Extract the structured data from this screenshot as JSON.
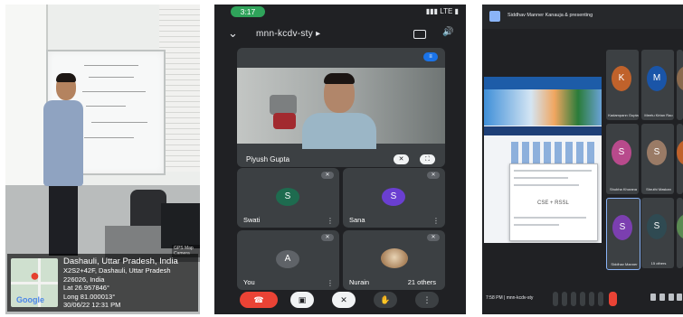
{
  "photo": {
    "geotag_title": "Dashauli, Uttar Pradesh, India",
    "address": "X2S2+42F, Dashauli, Uttar Pradesh 226026, India",
    "lat": "Lat 26.957846°",
    "long": "Long 81.000013°",
    "datetime": "30/06/22 12:31 PM",
    "map_label": "Google",
    "camera_badge": "GPS Map Camera"
  },
  "phone": {
    "status_time": "3:17",
    "status_right": "LTE",
    "meeting_code": "mnn-kcdv-sty",
    "main_tile_name": "Piyush Gupta",
    "tiles": [
      {
        "name": "Swati",
        "initial": "S",
        "color": "#1e6b4f"
      },
      {
        "name": "Sana",
        "initial": "S",
        "color": "#6a3fd1"
      },
      {
        "name": "You",
        "initial": "A",
        "color": "#5f6368"
      },
      {
        "name": "Nurain",
        "others": "21 others"
      }
    ]
  },
  "laptop": {
    "title": "Siddhav Manner Kanauja & presenting",
    "meeting_code": "7:58 PM | mnn-kcdv-sty",
    "popup_text": "CSE + RSSL",
    "participants": [
      {
        "name": "Kadampann Gupta",
        "initial": "K",
        "color": "#c0622b"
      },
      {
        "name": "Meetu Kirtan Rao",
        "initial": "M",
        "color": "#1a55a8"
      },
      {
        "name": "Gaurav Sharma",
        "initial": "G",
        "color": "#8a6a4e"
      },
      {
        "name": "Shubha Khurana",
        "initial": "S",
        "color": "#b84a8c"
      },
      {
        "name": "Shruthi Maskan",
        "initial": "S",
        "color": "#9a7b66"
      },
      {
        "name": "Harish Pillan",
        "initial": "H",
        "color": "#c0622b"
      },
      {
        "name": "Siddhav Manner",
        "initial": "S",
        "color": "#7b3fb0"
      },
      {
        "name": "15 others",
        "initial": "S",
        "color": "#2f4a52"
      },
      {
        "name": "Kamlesh",
        "initial": "S",
        "color": "#5a8a52"
      }
    ]
  }
}
